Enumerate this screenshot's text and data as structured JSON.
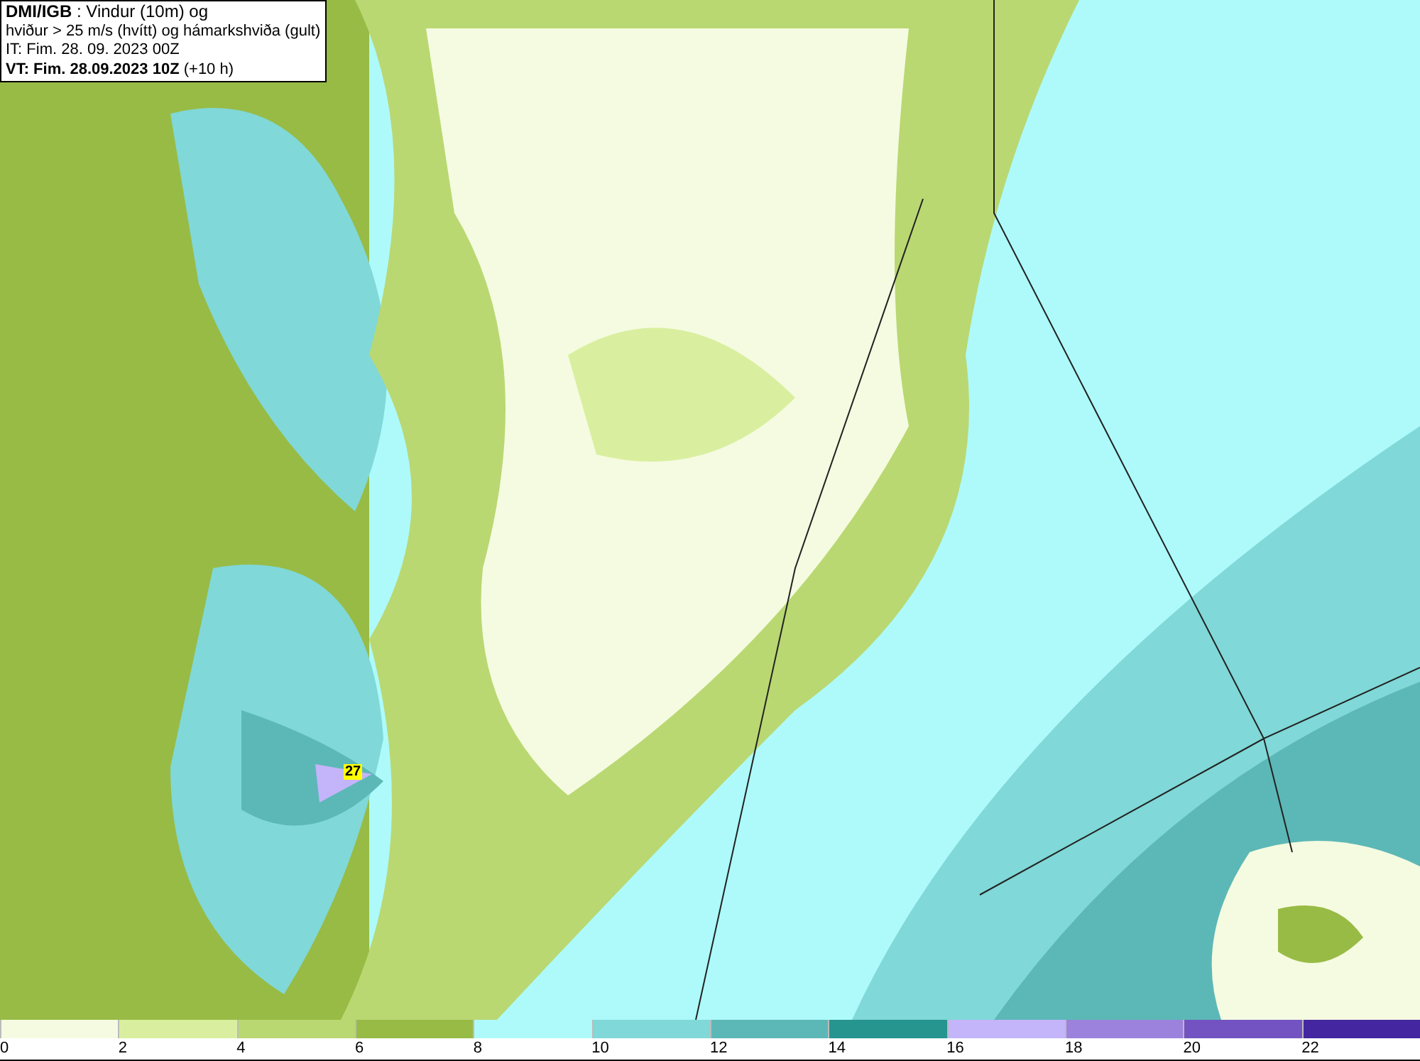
{
  "header": {
    "lines": [
      "**DMI/IGB** : Vindur (10m) og",
      "hviður > 25 m/s (hvítt) og hámarkshviða (gult)",
      "IT: Fim. 28. 09. 2023 00Z",
      "**VT: Fim. 28.09.2023 10Z** (+10 h)"
    ]
  },
  "map": {
    "gust_label": "27"
  },
  "legend": {
    "bins": [
      {
        "label": "0",
        "color": "#f5fbe0"
      },
      {
        "label": "2",
        "color": "#d9ef9f"
      },
      {
        "label": "4",
        "color": "#b9d872"
      },
      {
        "label": "6",
        "color": "#98bb45"
      },
      {
        "label": "8",
        "color": "#aefafa"
      },
      {
        "label": "10",
        "color": "#80d8d8"
      },
      {
        "label": "12",
        "color": "#5cb8b6"
      },
      {
        "label": "14",
        "color": "#26948f"
      },
      {
        "label": "16",
        "color": "#c4b4fa"
      },
      {
        "label": "18",
        "color": "#9c82dc"
      },
      {
        "label": "20",
        "color": "#7353c2"
      },
      {
        "label": "22",
        "color": "#4427a0"
      }
    ]
  }
}
